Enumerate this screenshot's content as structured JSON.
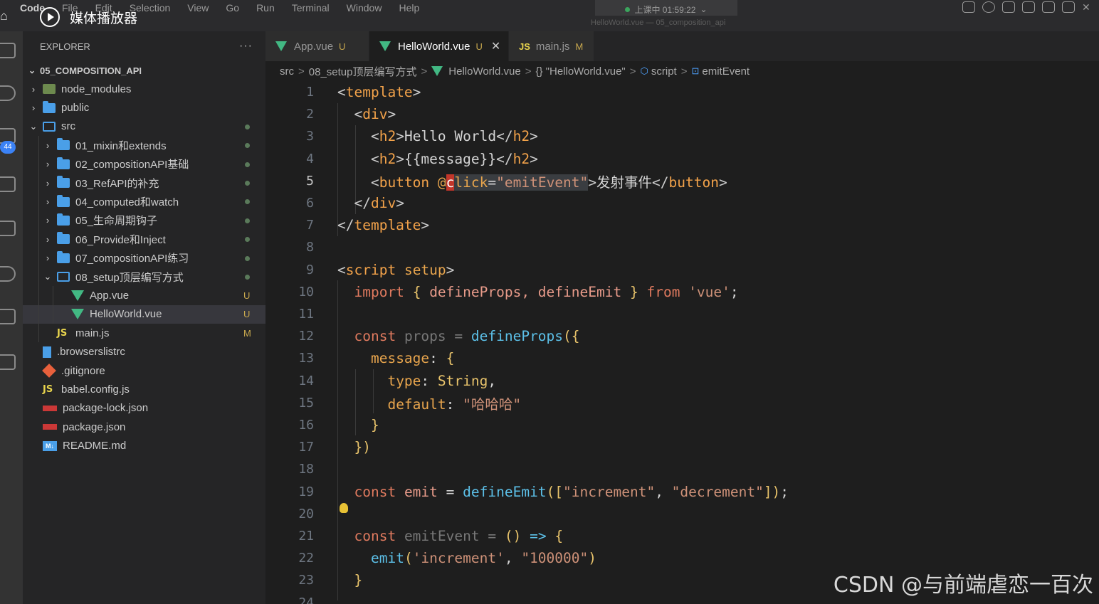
{
  "menubar": {
    "items": [
      "Code",
      "File",
      "Edit",
      "Selection",
      "View",
      "Go",
      "Run",
      "Terminal",
      "Window",
      "Help"
    ],
    "session": "上课中 01:59:22"
  },
  "window_title": "HelloWorld.vue — 05_composition_api",
  "player_label": "媒体播放器",
  "activity_badge": "44",
  "explorer": {
    "header": "EXPLORER",
    "more": "···",
    "project": "05_COMPOSITION_API",
    "rows": [
      {
        "name": "node_modules",
        "type": "node-folder",
        "depth": 1,
        "expanded": false,
        "status": ""
      },
      {
        "name": "public",
        "type": "folder",
        "depth": 1,
        "expanded": false,
        "status": ""
      },
      {
        "name": "src",
        "type": "folder-open",
        "depth": 1,
        "expanded": true,
        "status": "dot"
      },
      {
        "name": "01_mixin和extends",
        "type": "folder",
        "depth": 2,
        "expanded": false,
        "status": "dot"
      },
      {
        "name": "02_compositionAPI基础",
        "type": "folder",
        "depth": 2,
        "expanded": false,
        "status": "dot"
      },
      {
        "name": "03_RefAPI的补充",
        "type": "folder",
        "depth": 2,
        "expanded": false,
        "status": "dot"
      },
      {
        "name": "04_computed和watch",
        "type": "folder",
        "depth": 2,
        "expanded": false,
        "status": "dot"
      },
      {
        "name": "05_生命周期钩子",
        "type": "folder",
        "depth": 2,
        "expanded": false,
        "status": "dot"
      },
      {
        "name": "06_Provide和Inject",
        "type": "folder",
        "depth": 2,
        "expanded": false,
        "status": "dot"
      },
      {
        "name": "07_compositionAPI练习",
        "type": "folder",
        "depth": 2,
        "expanded": false,
        "status": "dot"
      },
      {
        "name": "08_setup顶层编写方式",
        "type": "folder-open",
        "depth": 2,
        "expanded": true,
        "status": "dot"
      },
      {
        "name": "App.vue",
        "type": "vue",
        "depth": 3,
        "status": "U"
      },
      {
        "name": "HelloWorld.vue",
        "type": "vue",
        "depth": 3,
        "status": "U",
        "selected": true
      },
      {
        "name": "main.js",
        "type": "js",
        "depth": 2,
        "status": "M"
      },
      {
        "name": ".browserslistrc",
        "type": "doc",
        "depth": 1,
        "status": ""
      },
      {
        "name": ".gitignore",
        "type": "git",
        "depth": 1,
        "status": ""
      },
      {
        "name": "babel.config.js",
        "type": "js",
        "depth": 1,
        "status": ""
      },
      {
        "name": "package-lock.json",
        "type": "npm",
        "depth": 1,
        "status": ""
      },
      {
        "name": "package.json",
        "type": "npm",
        "depth": 1,
        "status": ""
      },
      {
        "name": "README.md",
        "type": "md",
        "depth": 1,
        "status": ""
      }
    ]
  },
  "tabs": [
    {
      "label": "App.vue",
      "icon": "vue",
      "status": "U",
      "active": false
    },
    {
      "label": "HelloWorld.vue",
      "icon": "vue",
      "status": "U",
      "active": true
    },
    {
      "label": "main.js",
      "icon": "js",
      "status": "M",
      "active": false
    }
  ],
  "breadcrumb": [
    "src",
    "08_setup顶层编写方式",
    "HelloWorld.vue",
    "{} \"HelloWorld.vue\"",
    "script",
    "emitEvent"
  ],
  "editor": {
    "current_line": 5,
    "lines": [
      {
        "n": "1"
      },
      {
        "n": "2"
      },
      {
        "n": "3"
      },
      {
        "n": "4"
      },
      {
        "n": "5"
      },
      {
        "n": "6"
      },
      {
        "n": "7"
      },
      {
        "n": "8"
      },
      {
        "n": "9"
      },
      {
        "n": "10"
      },
      {
        "n": "11"
      },
      {
        "n": "12"
      },
      {
        "n": "13"
      },
      {
        "n": "14"
      },
      {
        "n": "15"
      },
      {
        "n": "16"
      },
      {
        "n": "17"
      },
      {
        "n": "18"
      },
      {
        "n": "19"
      },
      {
        "n": "20"
      },
      {
        "n": "21"
      },
      {
        "n": "22"
      },
      {
        "n": "23"
      },
      {
        "n": "24"
      }
    ],
    "code": {
      "l1_tag": "template",
      "l2_tag": "div",
      "l3_tag": "h2",
      "l3_text": "Hello World",
      "l4_tag": "h2",
      "l4_text": "{{message}}",
      "l5_tag": "button",
      "l5_at": "@",
      "l5_c": "c",
      "l5_attr": "lick",
      "l5_val": "\"emitEvent\"",
      "l5_text": "发射事件",
      "l6_tag": "div",
      "l7_tag": "template",
      "l9_tag": "script",
      "l9_attr": "setup",
      "l10_import": "import",
      "l10_names": "defineProps, defineEmit",
      "l10_from": "from",
      "l10_mod": "'vue'",
      "l12_const": "const",
      "l12_var": "props",
      "l12_fn": "defineProps",
      "l13_prop": "message",
      "l14_key": "type",
      "l14_val": "String",
      "l15_key": "default",
      "l15_val": "\"哈哈哈\"",
      "l19_const": "const",
      "l19_var": "emit",
      "l19_fn": "defineEmit",
      "l19_s1": "\"increment\"",
      "l19_s2": "\"decrement\"",
      "l21_const": "const",
      "l21_var": "emitEvent",
      "l22_fn": "emit",
      "l22_s1": "'increment'",
      "l22_s2": "\"100000\""
    }
  },
  "watermark": "CSDN @与前端虐恋一百次",
  "colors": {
    "accent_vue": "#42b883",
    "folder": "#4a9fe8",
    "status_modified": "#c8a84e"
  }
}
